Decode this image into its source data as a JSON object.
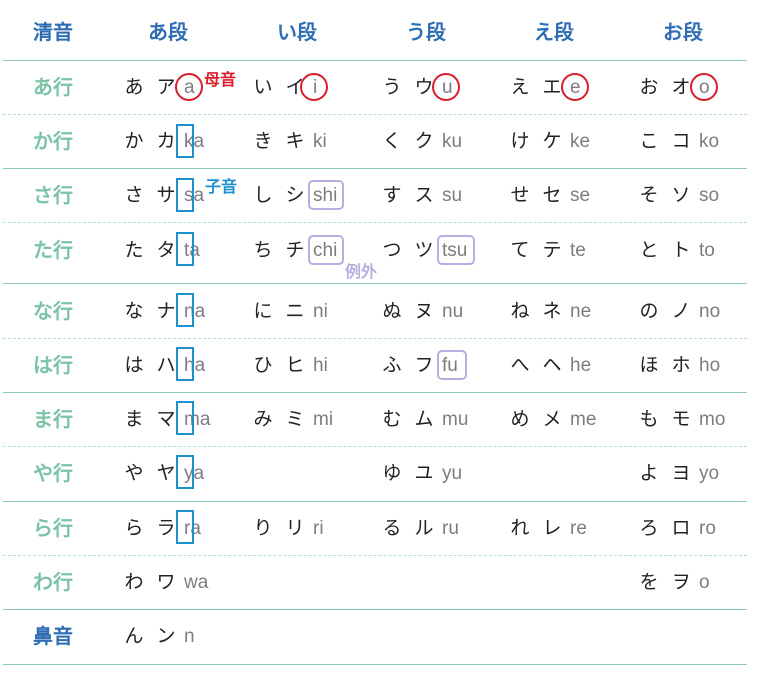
{
  "header": {
    "corner": "清音",
    "columns": [
      "あ段",
      "い段",
      "う段",
      "え段",
      "お段"
    ]
  },
  "rows": [
    {
      "label": "あ行",
      "cells": [
        {
          "hira": "あ",
          "kata": "ア",
          "roma": "a"
        },
        {
          "hira": "い",
          "kata": "イ",
          "roma": "i"
        },
        {
          "hira": "う",
          "kata": "ウ",
          "roma": "u"
        },
        {
          "hira": "え",
          "kata": "エ",
          "roma": "e"
        },
        {
          "hira": "お",
          "kata": "オ",
          "roma": "o"
        }
      ]
    },
    {
      "label": "か行",
      "cells": [
        {
          "hira": "か",
          "kata": "カ",
          "roma": "ka"
        },
        {
          "hira": "き",
          "kata": "キ",
          "roma": "ki"
        },
        {
          "hira": "く",
          "kata": "ク",
          "roma": "ku"
        },
        {
          "hira": "け",
          "kata": "ケ",
          "roma": "ke"
        },
        {
          "hira": "こ",
          "kata": "コ",
          "roma": "ko"
        }
      ]
    },
    {
      "label": "さ行",
      "cells": [
        {
          "hira": "さ",
          "kata": "サ",
          "roma": "sa"
        },
        {
          "hira": "し",
          "kata": "シ",
          "roma": "shi"
        },
        {
          "hira": "す",
          "kata": "ス",
          "roma": "su"
        },
        {
          "hira": "せ",
          "kata": "セ",
          "roma": "se"
        },
        {
          "hira": "そ",
          "kata": "ソ",
          "roma": "so"
        }
      ]
    },
    {
      "label": "た行",
      "cells": [
        {
          "hira": "た",
          "kata": "タ",
          "roma": "ta"
        },
        {
          "hira": "ち",
          "kata": "チ",
          "roma": "chi"
        },
        {
          "hira": "つ",
          "kata": "ツ",
          "roma": "tsu"
        },
        {
          "hira": "て",
          "kata": "テ",
          "roma": "te"
        },
        {
          "hira": "と",
          "kata": "ト",
          "roma": "to"
        }
      ]
    },
    {
      "label": "な行",
      "cells": [
        {
          "hira": "な",
          "kata": "ナ",
          "roma": "na"
        },
        {
          "hira": "に",
          "kata": "ニ",
          "roma": "ni"
        },
        {
          "hira": "ぬ",
          "kata": "ヌ",
          "roma": "nu"
        },
        {
          "hira": "ね",
          "kata": "ネ",
          "roma": "ne"
        },
        {
          "hira": "の",
          "kata": "ノ",
          "roma": "no"
        }
      ]
    },
    {
      "label": "は行",
      "cells": [
        {
          "hira": "は",
          "kata": "ハ",
          "roma": "ha"
        },
        {
          "hira": "ひ",
          "kata": "ヒ",
          "roma": "hi"
        },
        {
          "hira": "ふ",
          "kata": "フ",
          "roma": "fu"
        },
        {
          "hira": "へ",
          "kata": "ヘ",
          "roma": "he"
        },
        {
          "hira": "ほ",
          "kata": "ホ",
          "roma": "ho"
        }
      ]
    },
    {
      "label": "ま行",
      "cells": [
        {
          "hira": "ま",
          "kata": "マ",
          "roma": "ma"
        },
        {
          "hira": "み",
          "kata": "ミ",
          "roma": "mi"
        },
        {
          "hira": "む",
          "kata": "ム",
          "roma": "mu"
        },
        {
          "hira": "め",
          "kata": "メ",
          "roma": "me"
        },
        {
          "hira": "も",
          "kata": "モ",
          "roma": "mo"
        }
      ]
    },
    {
      "label": "や行",
      "cells": [
        {
          "hira": "や",
          "kata": "ヤ",
          "roma": "ya"
        },
        null,
        {
          "hira": "ゆ",
          "kata": "ユ",
          "roma": "yu"
        },
        null,
        {
          "hira": "よ",
          "kata": "ヨ",
          "roma": "yo"
        }
      ]
    },
    {
      "label": "ら行",
      "cells": [
        {
          "hira": "ら",
          "kata": "ラ",
          "roma": "ra"
        },
        {
          "hira": "り",
          "kata": "リ",
          "roma": "ri"
        },
        {
          "hira": "る",
          "kata": "ル",
          "roma": "ru"
        },
        {
          "hira": "れ",
          "kata": "レ",
          "roma": "re"
        },
        {
          "hira": "ろ",
          "kata": "ロ",
          "roma": "ro"
        }
      ]
    },
    {
      "label": "わ行",
      "cells": [
        {
          "hira": "わ",
          "kata": "ワ",
          "roma": "wa"
        },
        null,
        null,
        null,
        {
          "hira": "を",
          "kata": "ヲ",
          "roma": "o"
        }
      ]
    },
    {
      "label": "鼻音",
      "special": true,
      "cells": [
        {
          "hira": "ん",
          "kata": "ン",
          "roma": "n"
        },
        null,
        null,
        null,
        null
      ]
    }
  ],
  "annotations": {
    "vowel": "母音",
    "consonant": "子音",
    "exception": "例外"
  },
  "colors": {
    "vowel_circle": "#d81e2a",
    "consonant_box": "#1e90d0",
    "exception_box": "#b7aee0",
    "header_text": "#2e6cb4",
    "row_label_text": "#7cc3a6"
  }
}
